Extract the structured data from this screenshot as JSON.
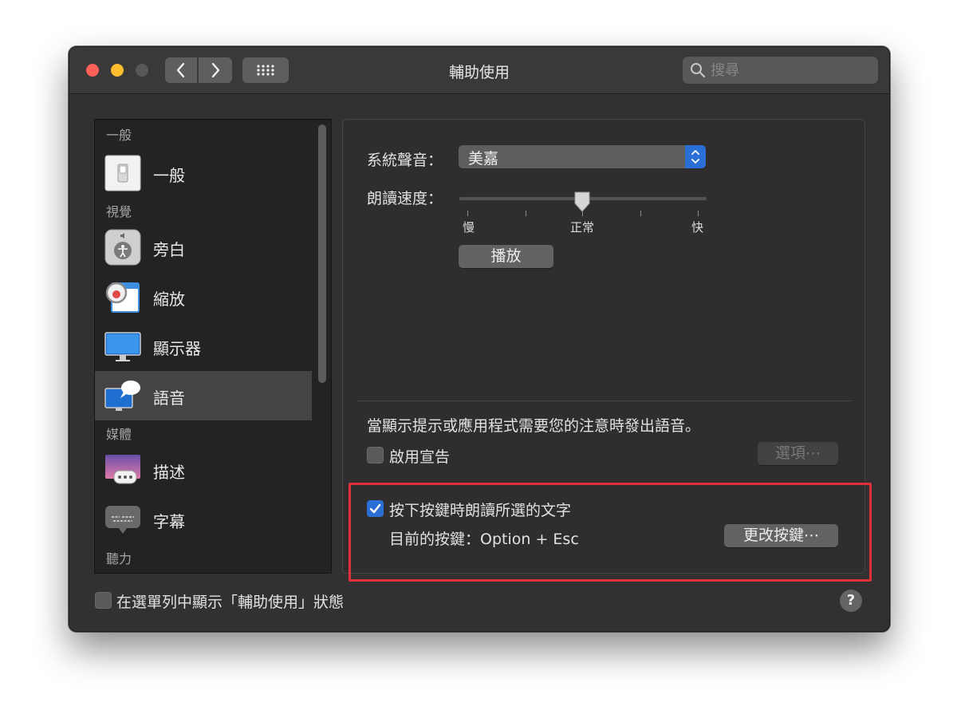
{
  "window": {
    "title": "輔助使用"
  },
  "search": {
    "placeholder": "搜尋"
  },
  "sidebar": {
    "headers": [
      "一般",
      "視覺",
      "媒體",
      "聽力"
    ],
    "items": [
      {
        "label": "一般"
      },
      {
        "label": "旁白"
      },
      {
        "label": "縮放"
      },
      {
        "label": "顯示器"
      },
      {
        "label": "語音",
        "selected": true
      },
      {
        "label": "描述"
      },
      {
        "label": "字幕"
      }
    ]
  },
  "speech": {
    "system_voice_label": "系統聲音：",
    "system_voice_value": "美嘉",
    "rate_label": "朗讀速度：",
    "rate_slow": "慢",
    "rate_normal": "正常",
    "rate_fast": "快",
    "rate_level": 0.5,
    "play_button": "播放"
  },
  "announcements": {
    "description": "當顯示提示或應用程式需要您的注意時發出語音。",
    "enable_label": "啟用宣告",
    "enable_checked": false,
    "options_button": "選項⋯"
  },
  "speak_selection": {
    "label": "按下按鍵時朗讀所選的文字",
    "checked": true,
    "current_key": "目前的按鍵：Option + Esc",
    "change_key_button": "更改按鍵⋯"
  },
  "footer": {
    "menu_bar_status_label": "在選單列中顯示「輔助使用」狀態",
    "menu_bar_status_checked": false,
    "help_label": "?"
  },
  "colors": {
    "accent": "#2b6fd6",
    "highlight_border": "#e0313b"
  }
}
